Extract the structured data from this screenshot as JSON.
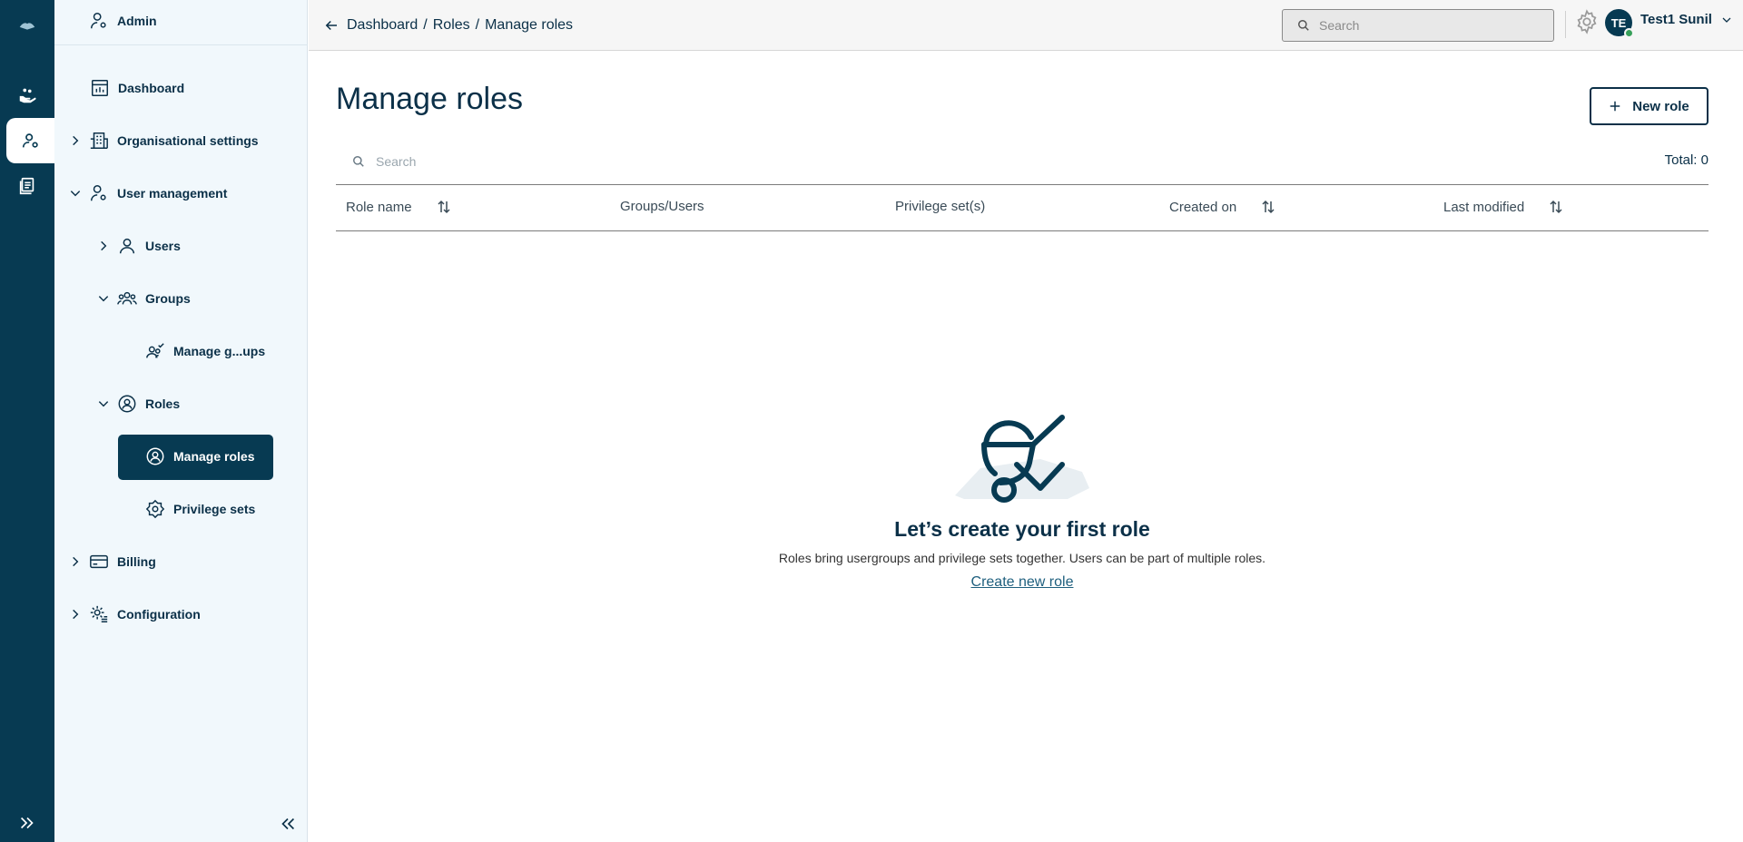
{
  "sidebar": {
    "header": "Admin",
    "items": {
      "dashboard": "Dashboard",
      "org_settings": "Organisational settings",
      "user_management": "User management",
      "users": "Users",
      "groups": "Groups",
      "manage_groups": "Manage g...ups",
      "roles": "Roles",
      "manage_roles": "Manage roles",
      "privilege_sets": "Privilege sets",
      "billing": "Billing",
      "configuration": "Configuration"
    }
  },
  "breadcrumb": [
    "Dashboard",
    "Roles",
    "Manage roles"
  ],
  "header": {
    "search_placeholder": "Search",
    "avatar_initials": "TE",
    "user_name": "Test1 Sunil"
  },
  "main": {
    "title": "Manage roles",
    "new_role_label": "New role",
    "search_placeholder": "Search",
    "total": "Total: 0",
    "columns": [
      "Role name",
      "Groups/Users",
      "Privilege set(s)",
      "Created on",
      "Last modified"
    ],
    "empty_title": "Let’s create your first role",
    "empty_text": "Roles bring usergroups and privilege sets together. Users can be part of multiple roles.",
    "empty_link": "Create new role"
  },
  "colors": {
    "brand_dark": "#073a52",
    "sidebar_bg": "#f1f8fc",
    "status_online": "#37a05a"
  }
}
